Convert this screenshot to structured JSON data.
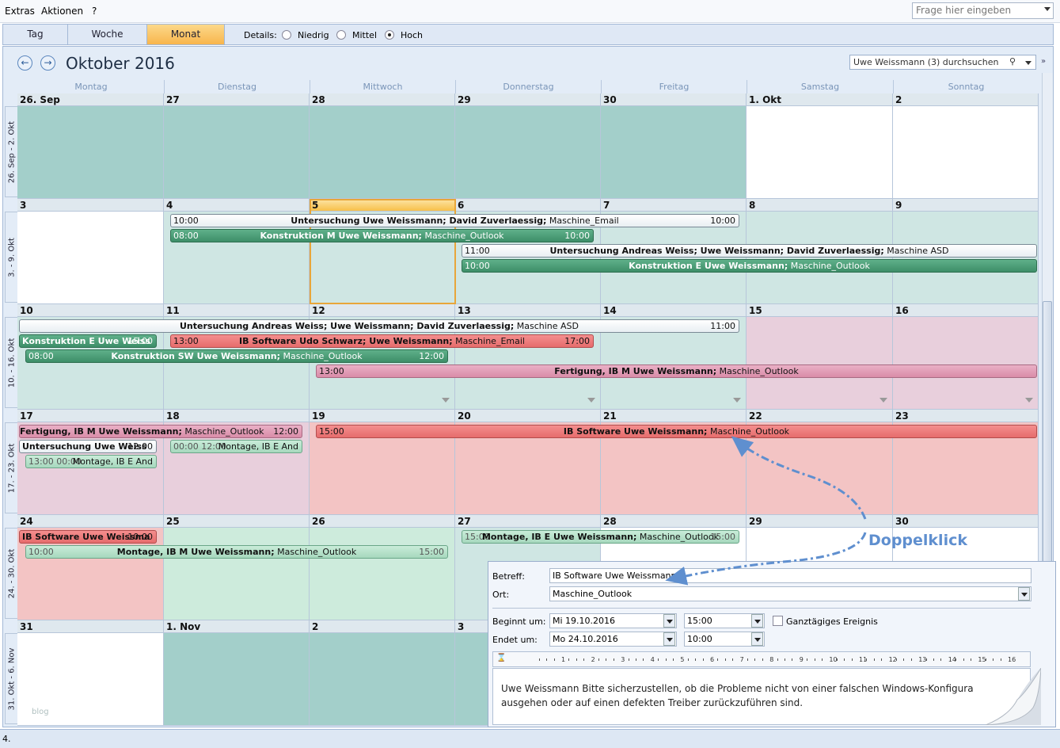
{
  "menu": {
    "extras": "Extras",
    "aktionen": "Aktionen",
    "help": "?"
  },
  "help_box": {
    "placeholder": "Frage hier eingeben"
  },
  "view_tabs": {
    "tag": "Tag",
    "woche": "Woche",
    "monat": "Monat",
    "active": "Monat"
  },
  "details": {
    "label": "Details:",
    "niedrig": "Niedrig",
    "mittel": "Mittel",
    "hoch": "Hoch",
    "selected": "Hoch"
  },
  "header": {
    "month_title": "Oktober 2016",
    "search_text": "Uwe Weissmann (3) durchsuchen"
  },
  "weekdays": [
    "Montag",
    "Dienstag",
    "Mittwoch",
    "Donnerstag",
    "Freitag",
    "Samstag",
    "Sonntag"
  ],
  "weeks": [
    {
      "label": "26. Sep - 2. Okt",
      "days": [
        "26. Sep",
        "27",
        "28",
        "29",
        "30",
        "1. Okt",
        "2"
      ]
    },
    {
      "label": "3. - 9. Okt",
      "days": [
        "3",
        "4",
        "5",
        "6",
        "7",
        "8",
        "9"
      ]
    },
    {
      "label": "10. - 16. Okt",
      "days": [
        "10",
        "11",
        "12",
        "13",
        "14",
        "15",
        "16"
      ]
    },
    {
      "label": "17. - 23. Okt",
      "days": [
        "17",
        "18",
        "19",
        "20",
        "21",
        "22",
        "23"
      ]
    },
    {
      "label": "24. - 30. Okt",
      "days": [
        "24",
        "25",
        "26",
        "27",
        "28",
        "29",
        "30"
      ]
    },
    {
      "label": "31. Okt - 6. Nov",
      "days": [
        "31",
        "1. Nov",
        "2",
        "3",
        "4",
        "5",
        "6"
      ]
    }
  ],
  "today": "5",
  "events": [
    {
      "title_bold": "Untersuchung Uwe Weissmann; David Zuverlaessig;",
      "title_rest": " Maschine_Email",
      "start": "10:00",
      "end": "10:00"
    },
    {
      "title_bold": "Konstruktion M Uwe Weissmann;",
      "title_rest": " Maschine_Outlook",
      "start": "08:00",
      "end": "10:00"
    },
    {
      "title_bold": "Untersuchung Andreas Weiss; Uwe Weissmann; David Zuverlaessig;",
      "title_rest": " Maschine ASD",
      "start": "11:00",
      "end": ""
    },
    {
      "title_bold": "Konstruktion E Uwe Weissmann;",
      "title_rest": " Maschine_Outlook",
      "start": "10:00",
      "end": ""
    },
    {
      "title_bold": "Untersuchung Andreas Weiss; Uwe Weissmann; David Zuverlaessig;",
      "title_rest": " Maschine ASD",
      "start": "",
      "end": "11:00"
    },
    {
      "title_bold": "Konstruktion E Uwe Weiss",
      "title_rest": "",
      "start": "",
      "end": "15:00"
    },
    {
      "title_bold": "IB Software Udo Schwarz; Uwe Weissmann;",
      "title_rest": " Maschine_Email",
      "start": "13:00",
      "end": "17:00"
    },
    {
      "title_bold": "Konstruktion SW Uwe Weissmann;",
      "title_rest": " Maschine_Outlook",
      "start": "08:00",
      "end": "12:00"
    },
    {
      "title_bold": "Fertigung, IB M Uwe Weissmann;",
      "title_rest": " Maschine_Outlook",
      "start": "13:00",
      "end": ""
    },
    {
      "title_bold": "Fertigung, IB M Uwe Weissmann;",
      "title_rest": " Maschine_Outlook",
      "start": "",
      "end": "12:00"
    },
    {
      "title_bold": "IB Software Uwe Weissmann;",
      "title_rest": " Maschine_Outlook",
      "start": "15:00",
      "end": ""
    },
    {
      "title_bold": "Untersuchung Uwe Weiss",
      "title_rest": "",
      "start": "",
      "end": "12:00"
    },
    {
      "title_bold": "",
      "title_rest": "Montage, IB E And",
      "start": "13:00 00:00",
      "end": ""
    },
    {
      "title_bold": "",
      "title_rest": "Montage, IB E And",
      "start": "00:00 12:00",
      "end": ""
    },
    {
      "title_bold": "IB Software Uwe Weissma",
      "title_rest": "",
      "start": "",
      "end": "10:00"
    },
    {
      "title_bold": "Montage, IB M Uwe Weissmann;",
      "title_rest": " Maschine_Outlook",
      "start": "10:00",
      "end": "15:00"
    },
    {
      "title_bold": "Montage, IB E Uwe Weissmann;",
      "title_rest": " Maschine_Outlook",
      "start": "15:00",
      "end": "15:00"
    }
  ],
  "popup": {
    "betreff_label": "Betreff:",
    "betreff_value": "IB Software Uwe Weissmann",
    "ort_label": "Ort:",
    "ort_value": "Maschine_Outlook",
    "beginnt_label": "Beginnt um:",
    "beginnt_date": "Mi 19.10.2016",
    "beginnt_time": "15:00",
    "ganztaegig_label": "Ganztägiges Ereignis",
    "endet_label": "Endet um:",
    "endet_date": "Mo 24.10.2016",
    "endet_time": "10:00",
    "ruler": [
      "1",
      "2",
      "3",
      "4",
      "5",
      "6",
      "7",
      "8",
      "9",
      "10",
      "11",
      "12",
      "13",
      "14",
      "15",
      "16"
    ],
    "notes_line1": "Uwe Weissmann  Bitte  sicherzustellen, ob die Probleme nicht von einer falschen Windows-Konfigura",
    "notes_line2": "ausgehen oder auf einen defekten Treiber zurückzuführen sind."
  },
  "annotation": {
    "doppelklick": "Doppelklick"
  },
  "watermark": "blog",
  "status": {
    "text": "4."
  },
  "colors": {
    "accent_orange": "#f8b54c",
    "workday_teal": "#a3cfca",
    "weekend_bg": "#ffffff",
    "ev_green": "#3d8e68",
    "ev_red": "#e66c6c",
    "ev_pink": "#d98ca8",
    "link_blue": "#5f8fcf"
  }
}
